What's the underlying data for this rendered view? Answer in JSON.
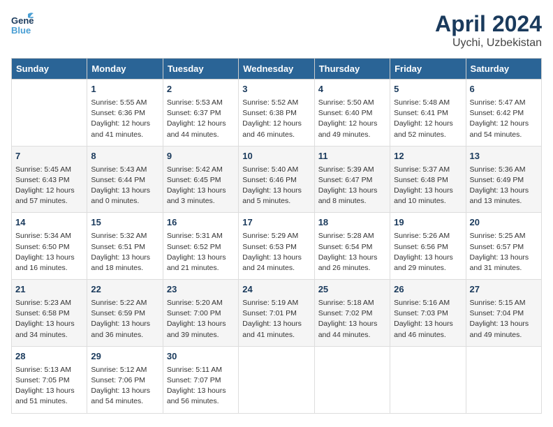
{
  "header": {
    "logo_line1": "General",
    "logo_line2": "Blue",
    "title": "April 2024",
    "subtitle": "Uychi, Uzbekistan"
  },
  "days_of_week": [
    "Sunday",
    "Monday",
    "Tuesday",
    "Wednesday",
    "Thursday",
    "Friday",
    "Saturday"
  ],
  "weeks": [
    [
      {
        "day": "",
        "info": ""
      },
      {
        "day": "1",
        "info": "Sunrise: 5:55 AM\nSunset: 6:36 PM\nDaylight: 12 hours\nand 41 minutes."
      },
      {
        "day": "2",
        "info": "Sunrise: 5:53 AM\nSunset: 6:37 PM\nDaylight: 12 hours\nand 44 minutes."
      },
      {
        "day": "3",
        "info": "Sunrise: 5:52 AM\nSunset: 6:38 PM\nDaylight: 12 hours\nand 46 minutes."
      },
      {
        "day": "4",
        "info": "Sunrise: 5:50 AM\nSunset: 6:40 PM\nDaylight: 12 hours\nand 49 minutes."
      },
      {
        "day": "5",
        "info": "Sunrise: 5:48 AM\nSunset: 6:41 PM\nDaylight: 12 hours\nand 52 minutes."
      },
      {
        "day": "6",
        "info": "Sunrise: 5:47 AM\nSunset: 6:42 PM\nDaylight: 12 hours\nand 54 minutes."
      }
    ],
    [
      {
        "day": "7",
        "info": "Sunrise: 5:45 AM\nSunset: 6:43 PM\nDaylight: 12 hours\nand 57 minutes."
      },
      {
        "day": "8",
        "info": "Sunrise: 5:43 AM\nSunset: 6:44 PM\nDaylight: 13 hours\nand 0 minutes."
      },
      {
        "day": "9",
        "info": "Sunrise: 5:42 AM\nSunset: 6:45 PM\nDaylight: 13 hours\nand 3 minutes."
      },
      {
        "day": "10",
        "info": "Sunrise: 5:40 AM\nSunset: 6:46 PM\nDaylight: 13 hours\nand 5 minutes."
      },
      {
        "day": "11",
        "info": "Sunrise: 5:39 AM\nSunset: 6:47 PM\nDaylight: 13 hours\nand 8 minutes."
      },
      {
        "day": "12",
        "info": "Sunrise: 5:37 AM\nSunset: 6:48 PM\nDaylight: 13 hours\nand 10 minutes."
      },
      {
        "day": "13",
        "info": "Sunrise: 5:36 AM\nSunset: 6:49 PM\nDaylight: 13 hours\nand 13 minutes."
      }
    ],
    [
      {
        "day": "14",
        "info": "Sunrise: 5:34 AM\nSunset: 6:50 PM\nDaylight: 13 hours\nand 16 minutes."
      },
      {
        "day": "15",
        "info": "Sunrise: 5:32 AM\nSunset: 6:51 PM\nDaylight: 13 hours\nand 18 minutes."
      },
      {
        "day": "16",
        "info": "Sunrise: 5:31 AM\nSunset: 6:52 PM\nDaylight: 13 hours\nand 21 minutes."
      },
      {
        "day": "17",
        "info": "Sunrise: 5:29 AM\nSunset: 6:53 PM\nDaylight: 13 hours\nand 24 minutes."
      },
      {
        "day": "18",
        "info": "Sunrise: 5:28 AM\nSunset: 6:54 PM\nDaylight: 13 hours\nand 26 minutes."
      },
      {
        "day": "19",
        "info": "Sunrise: 5:26 AM\nSunset: 6:56 PM\nDaylight: 13 hours\nand 29 minutes."
      },
      {
        "day": "20",
        "info": "Sunrise: 5:25 AM\nSunset: 6:57 PM\nDaylight: 13 hours\nand 31 minutes."
      }
    ],
    [
      {
        "day": "21",
        "info": "Sunrise: 5:23 AM\nSunset: 6:58 PM\nDaylight: 13 hours\nand 34 minutes."
      },
      {
        "day": "22",
        "info": "Sunrise: 5:22 AM\nSunset: 6:59 PM\nDaylight: 13 hours\nand 36 minutes."
      },
      {
        "day": "23",
        "info": "Sunrise: 5:20 AM\nSunset: 7:00 PM\nDaylight: 13 hours\nand 39 minutes."
      },
      {
        "day": "24",
        "info": "Sunrise: 5:19 AM\nSunset: 7:01 PM\nDaylight: 13 hours\nand 41 minutes."
      },
      {
        "day": "25",
        "info": "Sunrise: 5:18 AM\nSunset: 7:02 PM\nDaylight: 13 hours\nand 44 minutes."
      },
      {
        "day": "26",
        "info": "Sunrise: 5:16 AM\nSunset: 7:03 PM\nDaylight: 13 hours\nand 46 minutes."
      },
      {
        "day": "27",
        "info": "Sunrise: 5:15 AM\nSunset: 7:04 PM\nDaylight: 13 hours\nand 49 minutes."
      }
    ],
    [
      {
        "day": "28",
        "info": "Sunrise: 5:13 AM\nSunset: 7:05 PM\nDaylight: 13 hours\nand 51 minutes."
      },
      {
        "day": "29",
        "info": "Sunrise: 5:12 AM\nSunset: 7:06 PM\nDaylight: 13 hours\nand 54 minutes."
      },
      {
        "day": "30",
        "info": "Sunrise: 5:11 AM\nSunset: 7:07 PM\nDaylight: 13 hours\nand 56 minutes."
      },
      {
        "day": "",
        "info": ""
      },
      {
        "day": "",
        "info": ""
      },
      {
        "day": "",
        "info": ""
      },
      {
        "day": "",
        "info": ""
      }
    ]
  ]
}
